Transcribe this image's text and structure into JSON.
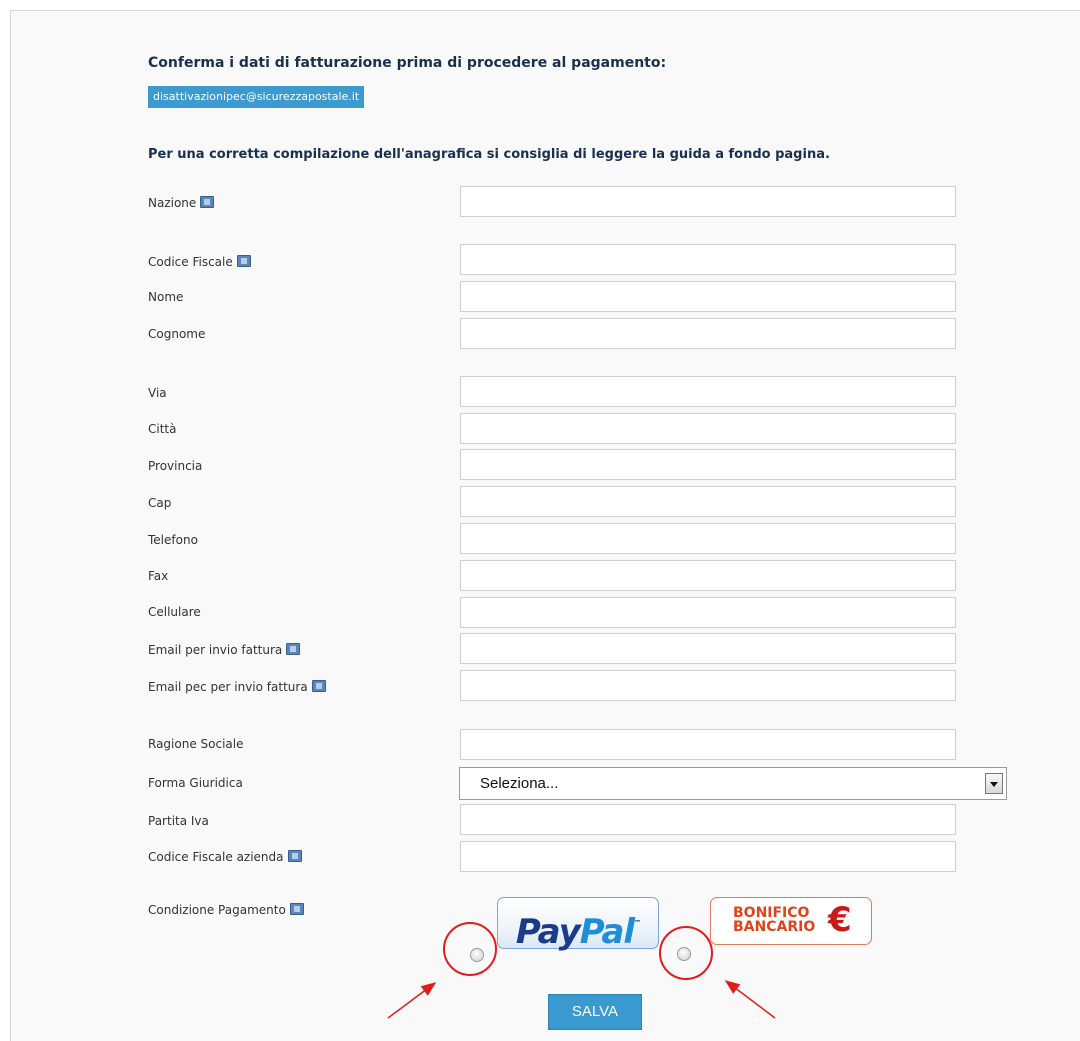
{
  "header": {
    "title": "Conferma i dati di fatturazione prima di procedere al pagamento:",
    "email": "disattivazionipec@sicurezzapostale.it",
    "hint": "Per una corretta compilazione dell'anagrafica si consiglia di leggere la guida a fondo pagina."
  },
  "form": {
    "nazione": {
      "label": "Nazione",
      "value": ""
    },
    "codice_fiscale": {
      "label": "Codice Fiscale",
      "value": ""
    },
    "nome": {
      "label": "Nome",
      "value": ""
    },
    "cognome": {
      "label": "Cognome",
      "value": ""
    },
    "via": {
      "label": "Via",
      "value": ""
    },
    "citta": {
      "label": "Città",
      "value": ""
    },
    "provincia": {
      "label": "Provincia",
      "value": ""
    },
    "cap": {
      "label": "Cap",
      "value": ""
    },
    "telefono": {
      "label": "Telefono",
      "value": ""
    },
    "fax": {
      "label": "Fax",
      "value": ""
    },
    "cellulare": {
      "label": "Cellulare",
      "value": ""
    },
    "email_fattura": {
      "label": "Email per invio fattura",
      "value": ""
    },
    "email_pec_fattura": {
      "label": "Email pec per invio fattura",
      "value": ""
    },
    "ragione_sociale": {
      "label": "Ragione Sociale",
      "value": ""
    },
    "forma_giuridica": {
      "label": "Forma Giuridica",
      "selected": "Seleziona..."
    },
    "partita_iva": {
      "label": "Partita Iva",
      "value": ""
    },
    "codice_fiscale_azienda": {
      "label": "Codice Fiscale azienda",
      "value": ""
    }
  },
  "payment": {
    "label": "Condizione Pagamento",
    "paypal_logo": {
      "part1": "Pay",
      "part2": "Pal",
      "tm": "™"
    },
    "bonifico_logo": {
      "text": "BONIFICO\nBANCARIO",
      "symbol": "€"
    },
    "paypal_selected": false,
    "bonifico_selected": false
  },
  "actions": {
    "save_label": "SALVA"
  },
  "colors": {
    "accent": "#3b9bd1",
    "heading": "#1a3050",
    "annotation": "#e21b1b"
  }
}
